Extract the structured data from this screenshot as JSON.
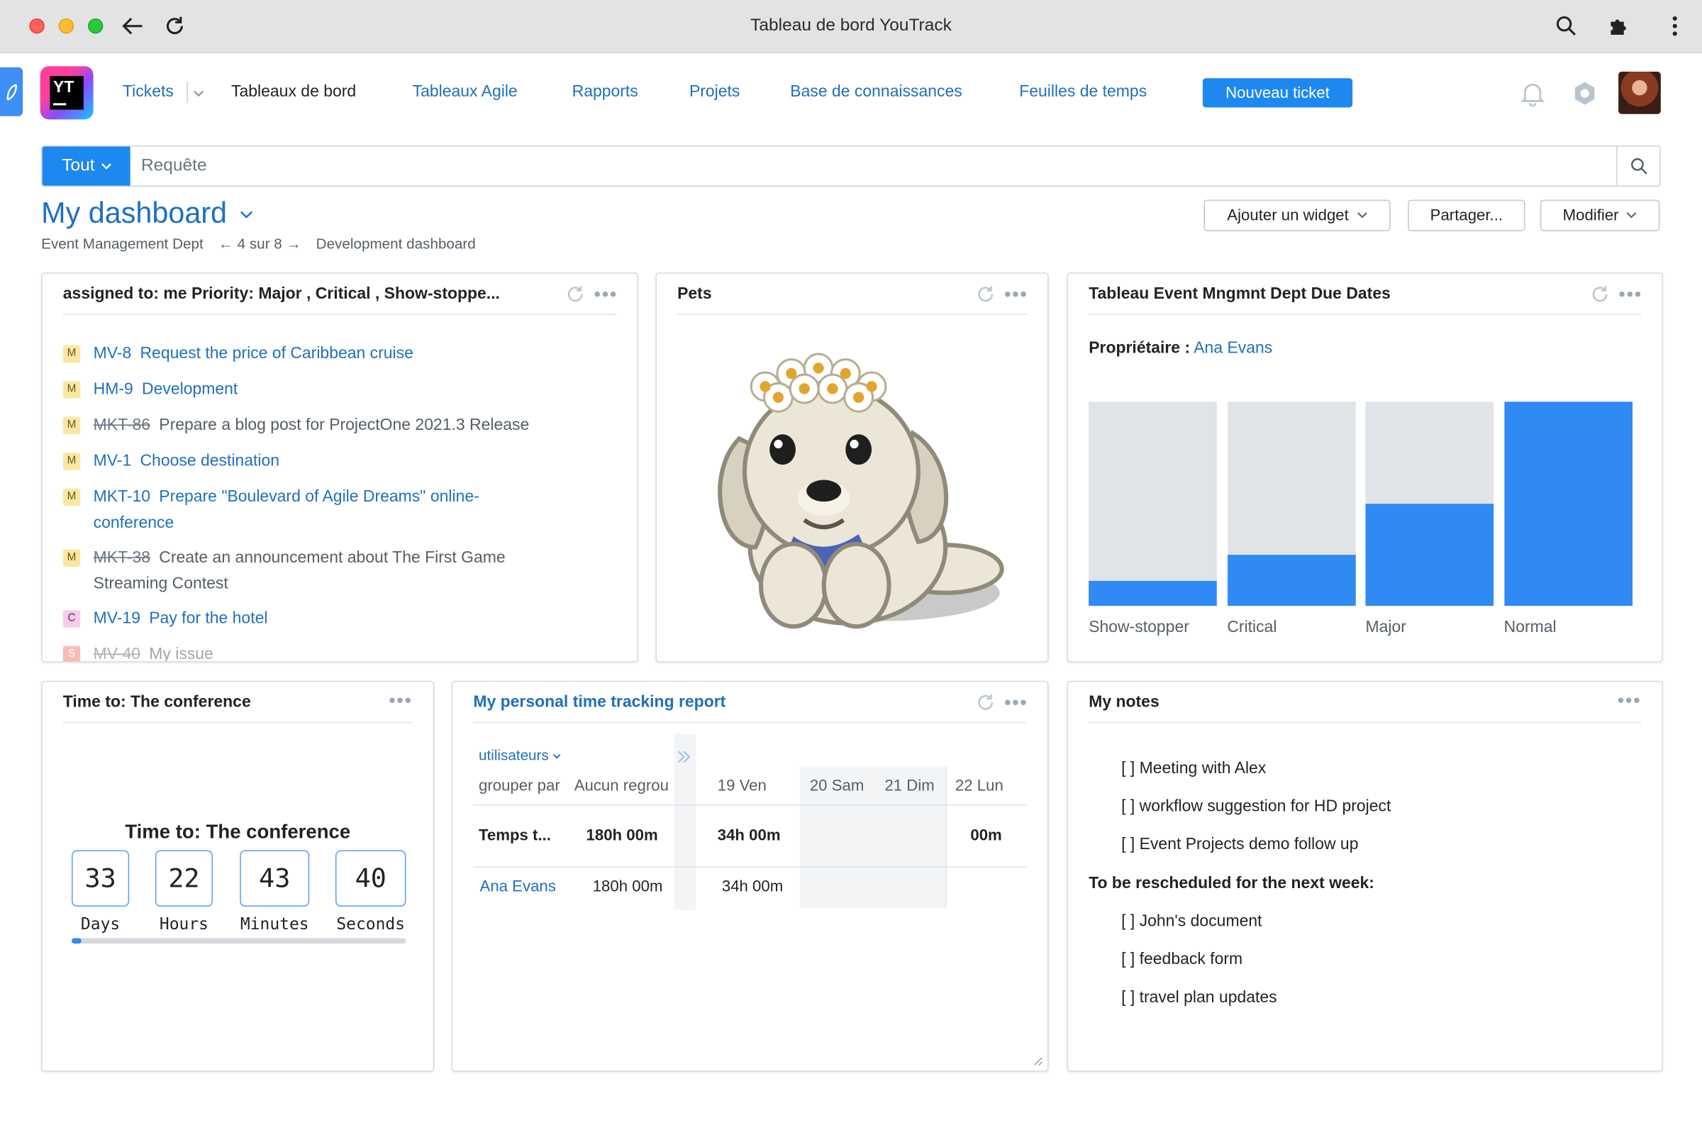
{
  "window": {
    "title": "Tableau de bord YouTrack"
  },
  "nav": {
    "items": [
      {
        "label": "Tickets"
      },
      {
        "label": "Tableaux de bord"
      },
      {
        "label": "Tableaux Agile"
      },
      {
        "label": "Rapports"
      },
      {
        "label": "Projets"
      },
      {
        "label": "Base de connaissances"
      },
      {
        "label": "Feuilles de temps"
      }
    ],
    "new_ticket": "Nouveau ticket",
    "logo_text": "YT"
  },
  "search": {
    "context": "Tout",
    "placeholder": "Requête",
    "value": ""
  },
  "dashboard": {
    "title": "My dashboard",
    "owner": "Event Management Dept",
    "pager": "4 sur 8",
    "next": "Development dashboard",
    "buttons": {
      "add_widget": "Ajouter un widget",
      "share": "Partager...",
      "edit": "Modifier"
    }
  },
  "widgets": {
    "issues": {
      "title": "assigned to: me Priority: Major , Critical , Show-stoppe...",
      "items": [
        {
          "priority": "M",
          "id": "MV-8",
          "summary": "Request the price of Caribbean cruise",
          "resolved": false
        },
        {
          "priority": "M",
          "id": "HM-9",
          "summary": "Development",
          "resolved": false
        },
        {
          "priority": "M",
          "id": "MKT-86",
          "summary": "Prepare a blog post for ProjectOne 2021.3 Release",
          "resolved": true
        },
        {
          "priority": "M",
          "id": "MV-1",
          "summary": "Choose destination",
          "resolved": false
        },
        {
          "priority": "M",
          "id": "MKT-10",
          "summary": "Prepare \"Boulevard of Agile Dreams\" online-conference",
          "resolved": false
        },
        {
          "priority": "M",
          "id": "MKT-38",
          "summary": "Create an announcement about The First Game Streaming Contest",
          "resolved": true
        },
        {
          "priority": "C",
          "id": "MV-19",
          "summary": "Pay for the hotel",
          "resolved": false
        },
        {
          "priority": "S",
          "id": "MV-40",
          "summary": "My issue",
          "resolved": true
        }
      ]
    },
    "pets": {
      "title": "Pets",
      "image": "puppy-with-flower-crown"
    },
    "due_dates": {
      "title": "Tableau Event Mngmnt Dept Due Dates",
      "owner_label": "Propriétaire :",
      "owner": "Ana Evans"
    },
    "countdown": {
      "title": "Time to: The conference",
      "heading": "Time to: The conference",
      "units": [
        {
          "value": "33",
          "label": "Days"
        },
        {
          "value": "22",
          "label": "Hours"
        },
        {
          "value": "43",
          "label": "Minutes"
        },
        {
          "value": "40",
          "label": "Seconds"
        }
      ],
      "progress": 0.03
    },
    "time_tracking": {
      "title": "My personal time tracking report",
      "group_selector": "utilisateurs",
      "group_by_label": "grouper par",
      "group_by_value": "Aucun regrou",
      "days": [
        "19 Ven",
        "20 Sam",
        "21 Dim",
        "22 Lun"
      ],
      "total_row": {
        "label": "Temps t...",
        "total": "180h 00m",
        "d19": "34h 00m",
        "d22": "00m"
      },
      "user_row": {
        "label": "Ana Evans",
        "total": "180h 00m",
        "d19": "34h 00m"
      }
    },
    "notes": {
      "title": "My notes",
      "items": [
        "[ ] Meeting with Alex",
        "[ ] workflow suggestion for HD project",
        "[ ] Event Projects demo follow up"
      ],
      "subheading": "To be rescheduled for the next week:",
      "items2": [
        "[ ] John's document",
        "[ ] feedback form",
        "[ ] travel plan updates"
      ]
    }
  },
  "colors": {
    "accent": "#1d88f0",
    "link": "#1f6fbf",
    "bar": "#2f8af3",
    "bar_bg": "#e0e3e7"
  },
  "chart_data": {
    "type": "bar",
    "categories": [
      "Show-stopper",
      "Critical",
      "Major",
      "Normal"
    ],
    "series": [
      {
        "values": [
          12,
          25,
          50,
          100
        ]
      }
    ],
    "ylim": [
      0,
      100
    ],
    "note_unit": "percent of issues on time per priority (bar fill)"
  }
}
